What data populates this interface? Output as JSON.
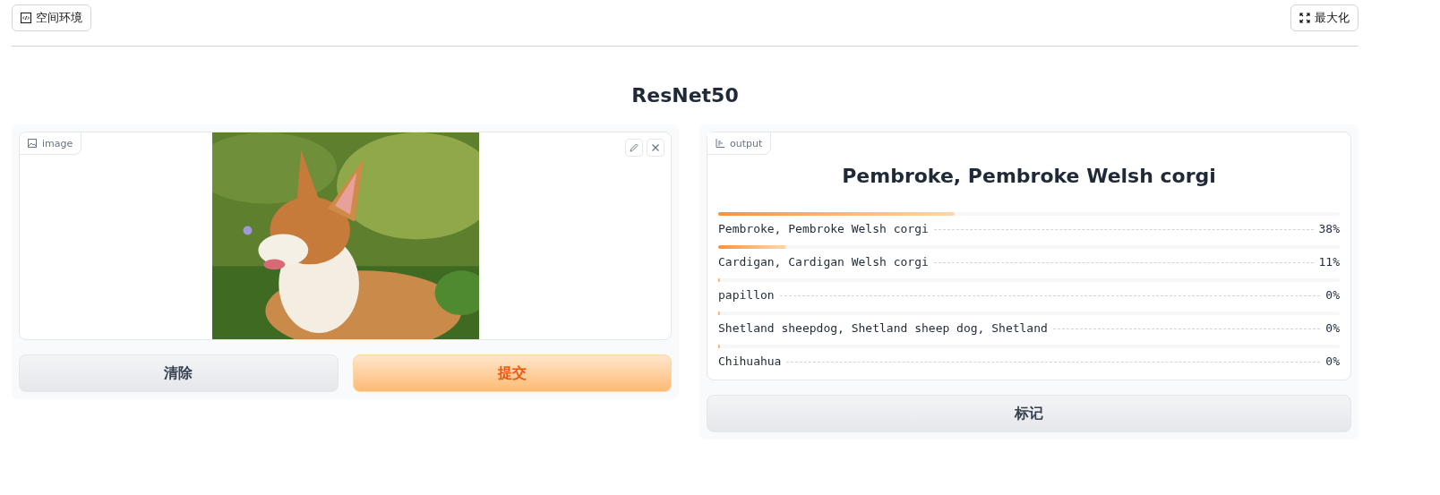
{
  "header": {
    "left_button": "空间环境",
    "right_button": "最大化"
  },
  "title": "ResNet50",
  "input_panel": {
    "label": "image",
    "buttons": [
      {
        "label": "清除",
        "kind": "secondary"
      },
      {
        "label": "提交",
        "kind": "primary"
      }
    ]
  },
  "output_panel": {
    "label": "output",
    "top_label": "Pembroke, Pembroke Welsh corgi",
    "confidences": [
      {
        "label": "Pembroke, Pembroke Welsh corgi",
        "level": 0.38,
        "reading": "38%"
      },
      {
        "label": "Cardigan, Cardigan Welsh corgi",
        "level": 0.11,
        "reading": "11%"
      },
      {
        "label": "papillon",
        "level": 0.003,
        "reading": "0%"
      },
      {
        "label": "Shetland sheepdog, Shetland sheep dog, Shetland",
        "level": 0.003,
        "reading": "0%"
      },
      {
        "label": "Chihuahua",
        "level": 0.002,
        "reading": "0%"
      }
    ],
    "buttons": [
      {
        "label": "标记",
        "kind": "secondary"
      }
    ]
  }
}
